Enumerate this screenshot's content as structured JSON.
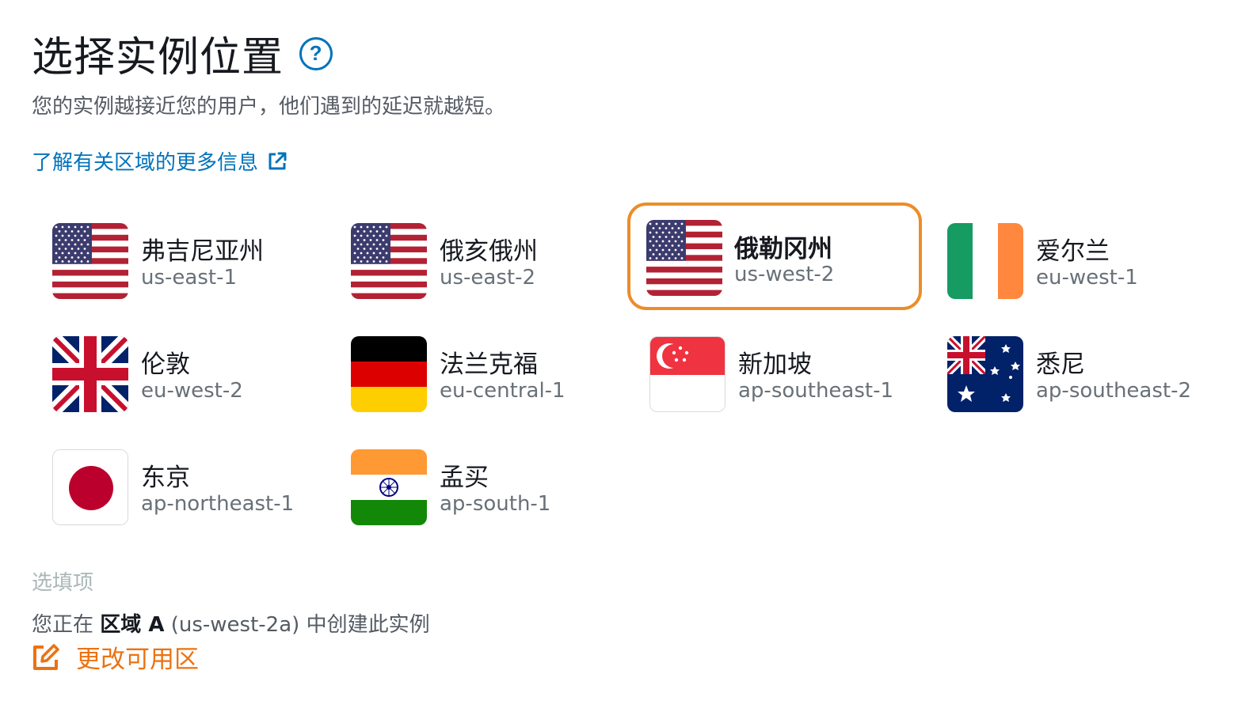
{
  "header": {
    "title": "选择实例位置",
    "help_glyph": "?",
    "subtitle": "您的实例越接近您的用户，他们遇到的延迟就越短。",
    "learn_more": "了解有关区域的更多信息"
  },
  "regions": [
    {
      "name": "弗吉尼亚州",
      "code": "us-east-1",
      "flag": "us-flag-icon",
      "selected": false
    },
    {
      "name": "俄亥俄州",
      "code": "us-east-2",
      "flag": "us-flag-icon",
      "selected": false
    },
    {
      "name": "俄勒冈州",
      "code": "us-west-2",
      "flag": "us-flag-icon",
      "selected": true
    },
    {
      "name": "爱尔兰",
      "code": "eu-west-1",
      "flag": "ireland-flag-icon",
      "selected": false
    },
    {
      "name": "伦敦",
      "code": "eu-west-2",
      "flag": "uk-flag-icon",
      "selected": false
    },
    {
      "name": "法兰克福",
      "code": "eu-central-1",
      "flag": "germany-flag-icon",
      "selected": false
    },
    {
      "name": "新加坡",
      "code": "ap-southeast-1",
      "flag": "singapore-flag-icon",
      "selected": false
    },
    {
      "name": "悉尼",
      "code": "ap-southeast-2",
      "flag": "australia-flag-icon",
      "selected": false
    },
    {
      "name": "东京",
      "code": "ap-northeast-1",
      "flag": "japan-flag-icon",
      "selected": false
    },
    {
      "name": "孟买",
      "code": "ap-south-1",
      "flag": "india-flag-icon",
      "selected": false
    }
  ],
  "availability": {
    "optional_label": "选填项",
    "prefix": "您正在",
    "zone": "区域 A",
    "zone_code": "(us-west-2a)",
    "suffix": "中创建此实例",
    "change_label": "更改可用区"
  },
  "colors": {
    "link": "#0073bb",
    "selected_border": "#ec8d28",
    "action": "#ec7211"
  }
}
